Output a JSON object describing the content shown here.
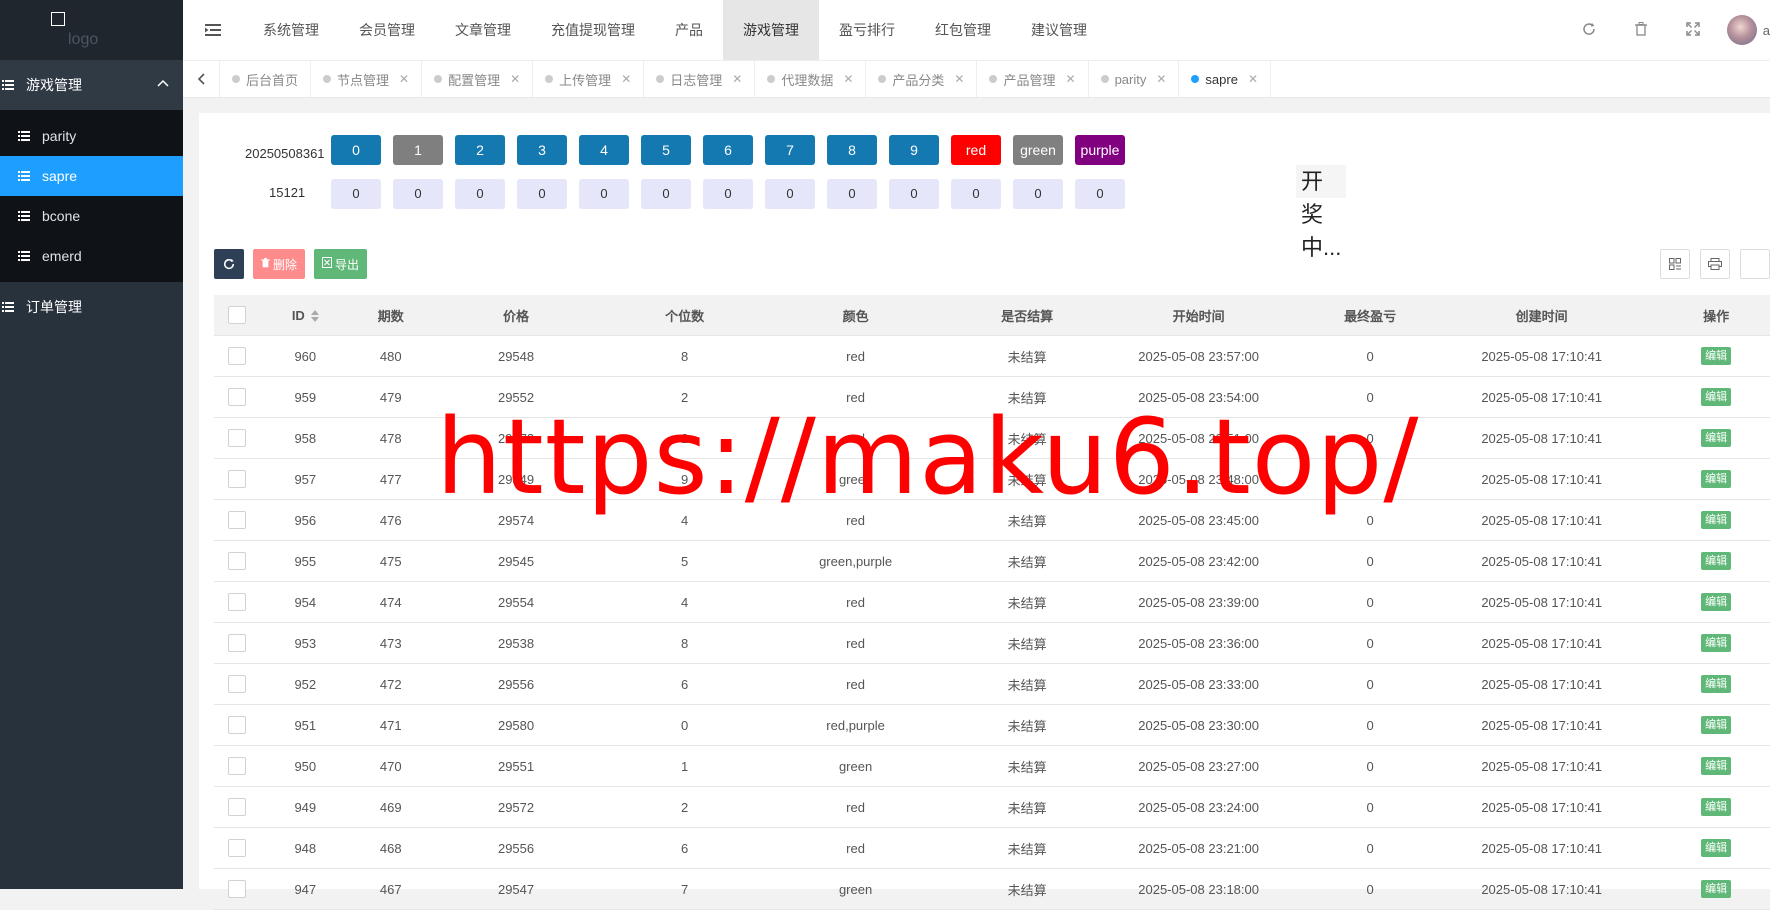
{
  "logo": {
    "text": "logo"
  },
  "sidebar": {
    "group_label": "游戏管理",
    "sub_items": [
      {
        "label": "parity",
        "active": false
      },
      {
        "label": "sapre",
        "active": true
      },
      {
        "label": "bcone",
        "active": false
      },
      {
        "label": "emerd",
        "active": false
      }
    ],
    "order_label": "订单管理"
  },
  "top_menu": [
    {
      "label": "系统管理",
      "active": false
    },
    {
      "label": "会员管理",
      "active": false
    },
    {
      "label": "文章管理",
      "active": false
    },
    {
      "label": "充值提现管理",
      "active": false
    },
    {
      "label": "产品",
      "active": false
    },
    {
      "label": "游戏管理",
      "active": true
    },
    {
      "label": "盈亏排行",
      "active": false
    },
    {
      "label": "红包管理",
      "active": false
    },
    {
      "label": "建议管理",
      "active": false
    }
  ],
  "user": {
    "name": "a"
  },
  "tabs": [
    {
      "label": "后台首页",
      "closable": false,
      "active": false
    },
    {
      "label": "节点管理",
      "closable": true,
      "active": false
    },
    {
      "label": "配置管理",
      "closable": true,
      "active": false
    },
    {
      "label": "上传管理",
      "closable": true,
      "active": false
    },
    {
      "label": "日志管理",
      "closable": true,
      "active": false
    },
    {
      "label": "代理数据",
      "closable": true,
      "active": false
    },
    {
      "label": "产品分类",
      "closable": true,
      "active": false
    },
    {
      "label": "产品管理",
      "closable": true,
      "active": false
    },
    {
      "label": "parity",
      "closable": true,
      "active": false
    },
    {
      "label": "sapre",
      "closable": true,
      "active": true
    }
  ],
  "draw": {
    "issue": "20250508361",
    "sub": "15121",
    "status": "开奖中...",
    "options": [
      {
        "label": "0",
        "style": "blue",
        "count": "0"
      },
      {
        "label": "1",
        "style": "gray",
        "count": "0"
      },
      {
        "label": "2",
        "style": "blue",
        "count": "0"
      },
      {
        "label": "3",
        "style": "blue",
        "count": "0"
      },
      {
        "label": "4",
        "style": "blue",
        "count": "0"
      },
      {
        "label": "5",
        "style": "blue",
        "count": "0"
      },
      {
        "label": "6",
        "style": "blue",
        "count": "0"
      },
      {
        "label": "7",
        "style": "blue",
        "count": "0"
      },
      {
        "label": "8",
        "style": "blue",
        "count": "0"
      },
      {
        "label": "9",
        "style": "blue",
        "count": "0"
      },
      {
        "label": "red",
        "style": "red",
        "count": "0"
      },
      {
        "label": "green",
        "style": "green",
        "count": "0"
      },
      {
        "label": "purple",
        "style": "purple",
        "count": "0"
      }
    ]
  },
  "toolbar": {
    "delete_label": "删除",
    "export_label": "导出"
  },
  "table": {
    "headers": [
      "ID",
      "期数",
      "价格",
      "个位数",
      "颜色",
      "是否结算",
      "开始时间",
      "最终盈亏",
      "创建时间",
      "操作"
    ],
    "edit_label": "编辑",
    "rows": [
      [
        "960",
        "480",
        "29548",
        "8",
        "red",
        "未结算",
        "2025-05-08 23:57:00",
        "0",
        "2025-05-08 17:10:41"
      ],
      [
        "959",
        "479",
        "29552",
        "2",
        "red",
        "未结算",
        "2025-05-08 23:54:00",
        "0",
        "2025-05-08 17:10:41"
      ],
      [
        "958",
        "478",
        "29572",
        "2",
        "red",
        "未结算",
        "2025-05-08 23:51:00",
        "0",
        "2025-05-08 17:10:41"
      ],
      [
        "957",
        "477",
        "29549",
        "9",
        "green",
        "未结算",
        "2025-05-08 23:48:00",
        "0",
        "2025-05-08 17:10:41"
      ],
      [
        "956",
        "476",
        "29574",
        "4",
        "red",
        "未结算",
        "2025-05-08 23:45:00",
        "0",
        "2025-05-08 17:10:41"
      ],
      [
        "955",
        "475",
        "29545",
        "5",
        "green,purple",
        "未结算",
        "2025-05-08 23:42:00",
        "0",
        "2025-05-08 17:10:41"
      ],
      [
        "954",
        "474",
        "29554",
        "4",
        "red",
        "未结算",
        "2025-05-08 23:39:00",
        "0",
        "2025-05-08 17:10:41"
      ],
      [
        "953",
        "473",
        "29538",
        "8",
        "red",
        "未结算",
        "2025-05-08 23:36:00",
        "0",
        "2025-05-08 17:10:41"
      ],
      [
        "952",
        "472",
        "29556",
        "6",
        "red",
        "未结算",
        "2025-05-08 23:33:00",
        "0",
        "2025-05-08 17:10:41"
      ],
      [
        "951",
        "471",
        "29580",
        "0",
        "red,purple",
        "未结算",
        "2025-05-08 23:30:00",
        "0",
        "2025-05-08 17:10:41"
      ],
      [
        "950",
        "470",
        "29551",
        "1",
        "green",
        "未结算",
        "2025-05-08 23:27:00",
        "0",
        "2025-05-08 17:10:41"
      ],
      [
        "949",
        "469",
        "29572",
        "2",
        "red",
        "未结算",
        "2025-05-08 23:24:00",
        "0",
        "2025-05-08 17:10:41"
      ],
      [
        "948",
        "468",
        "29556",
        "6",
        "red",
        "未结算",
        "2025-05-08 23:21:00",
        "0",
        "2025-05-08 17:10:41"
      ],
      [
        "947",
        "467",
        "29547",
        "7",
        "green",
        "未结算",
        "2025-05-08 23:18:00",
        "0",
        "2025-05-08 17:10:41"
      ]
    ]
  },
  "watermark": "https://maku6.top/"
}
